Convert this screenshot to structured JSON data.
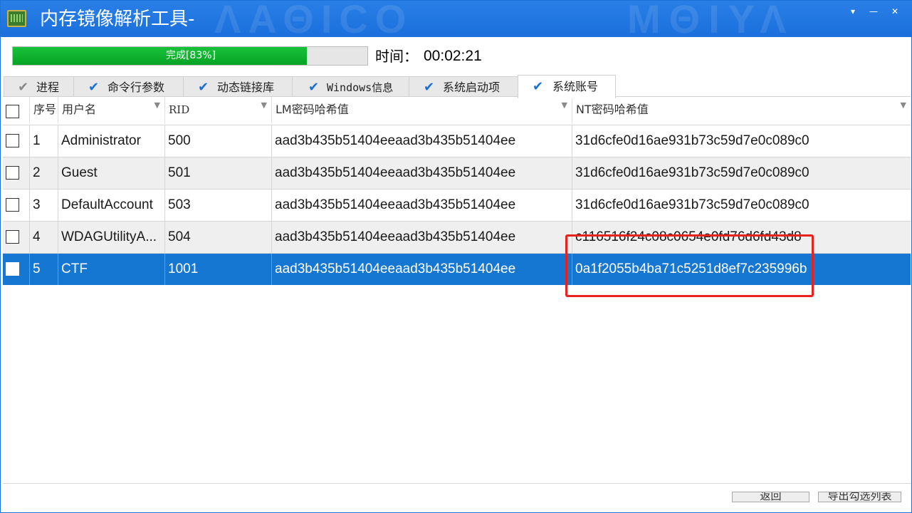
{
  "window": {
    "title": "内存镜像解析工具-",
    "watermark_left": "ΛΑΘΙCΟ",
    "watermark_right": "ΜΘΙΥΛ",
    "controls": {
      "dropdown": "▾",
      "minimize": "—",
      "close": "✕"
    }
  },
  "progress": {
    "label": "完成[83%]",
    "value": 0.83
  },
  "timer": {
    "label": "时间：",
    "value": "00:02:21"
  },
  "tabs": [
    {
      "label": "进程",
      "checked": true
    },
    {
      "label": "命令行参数",
      "checked": true
    },
    {
      "label": "动态链接库",
      "checked": true
    },
    {
      "label": "Windows信息",
      "checked": true
    },
    {
      "label": "系统启动项",
      "checked": true
    },
    {
      "label": "系统账号",
      "checked": true,
      "active": true
    }
  ],
  "table": {
    "columns": [
      "序号",
      "用户名",
      "RID",
      "LM密码哈希值",
      "NT密码哈希值"
    ],
    "rows": [
      {
        "index": "1",
        "username": "Administrator",
        "rid": "500",
        "lm": "aad3b435b51404eeaad3b435b51404ee",
        "nt": "31d6cfe0d16ae931b73c59d7e0c089c0"
      },
      {
        "index": "2",
        "username": "Guest",
        "rid": "501",
        "lm": "aad3b435b51404eeaad3b435b51404ee",
        "nt": "31d6cfe0d16ae931b73c59d7e0c089c0"
      },
      {
        "index": "3",
        "username": "DefaultAccount",
        "rid": "503",
        "lm": "aad3b435b51404eeaad3b435b51404ee",
        "nt": "31d6cfe0d16ae931b73c59d7e0c089c0"
      },
      {
        "index": "4",
        "username": "WDAGUtilityA...",
        "rid": "504",
        "lm": "aad3b435b51404eeaad3b435b51404ee",
        "nt": "c116516f24c08c0654e0fd76d6fd43d8"
      },
      {
        "index": "5",
        "username": "CTF",
        "rid": "1001",
        "lm": "aad3b435b51404eeaad3b435b51404ee",
        "nt": "0a1f2055b4ba71c5251d8ef7c235996b"
      }
    ],
    "selected_row": 5
  },
  "footer": {
    "back_button": "返回",
    "export_button": "导出勾选列表"
  },
  "colors": {
    "titlebar": "#1a6fdc",
    "progress_fill": "#0fb52f",
    "selection": "#1677d2",
    "annotation": "#e8231f",
    "tab_check": "#1a70d8"
  },
  "icons": [
    "app-icon",
    "dropdown-icon",
    "minimize-icon",
    "close-icon",
    "check-icon",
    "filter-icon"
  ]
}
